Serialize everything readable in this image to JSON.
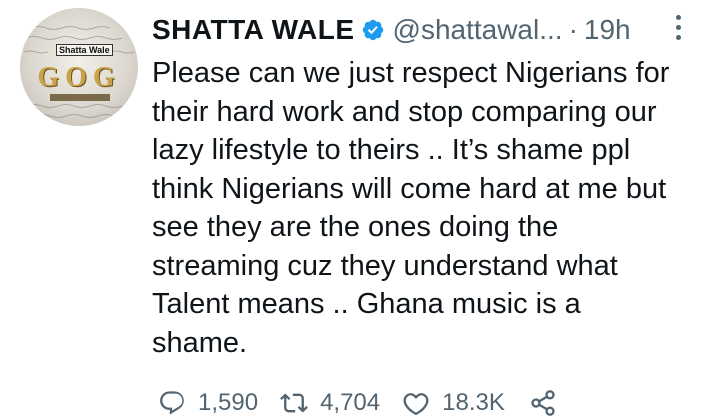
{
  "tweet": {
    "author_name": "SHATTA WALE",
    "handle": "@shattawal...",
    "separator": "·",
    "time": "19h",
    "avatar_text": {
      "badge": "Shatta Wale",
      "logo": "GOG"
    },
    "text": "Please can we just respect Nigerians for\ntheir hard work and stop comparing our\nlazy lifestyle to theirs .. It’s shame ppl\nthink Nigerians will come hard at me but\nsee they are the ones doing the\nstreaming cuz they understand what\nTalent means .. Ghana music is a\nshame.",
    "actions": {
      "replies": "1,590",
      "retweets": "4,704",
      "likes": "18.3K"
    }
  },
  "icons": {
    "verified": "verified-badge-icon",
    "more": "more-vertical-icon",
    "reply": "reply-icon",
    "retweet": "retweet-icon",
    "like": "heart-icon",
    "share": "share-icon"
  },
  "colors": {
    "verified": "#1d9bf0",
    "secondary_text": "#536471",
    "primary_text": "#0f1419"
  }
}
